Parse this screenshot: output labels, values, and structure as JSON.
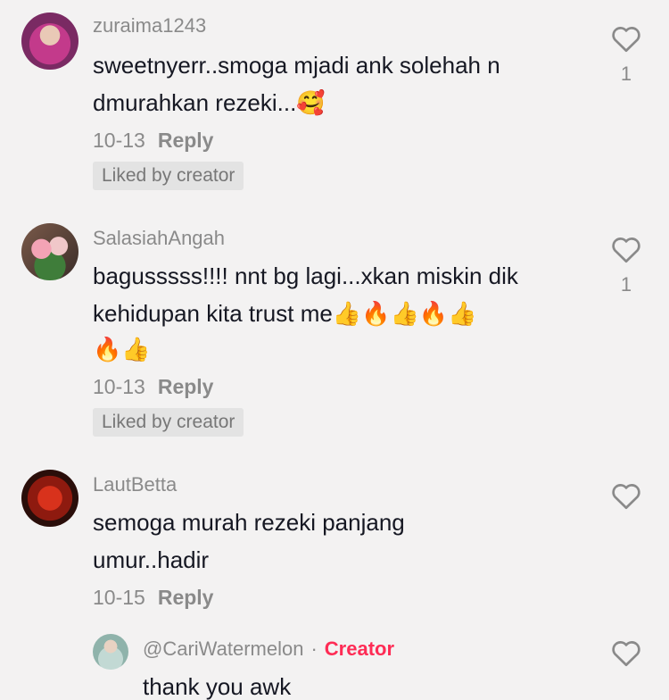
{
  "comments": [
    {
      "username": "zuraima1243",
      "lines": [
        "sweetnyerr..smoga mjadi ank solehah n",
        "dmurahkan rezeki...🥰"
      ],
      "date": "10-13",
      "reply_label": "Reply",
      "badge": "Liked by creator",
      "likes": "1",
      "heart_icon": "heart-outline-icon"
    },
    {
      "username": "SalasiahAngah",
      "lines": [
        "bagusssss!!!! nnt bg lagi...xkan miskin dik",
        "kehidupan kita trust me👍🔥👍🔥👍",
        "🔥👍"
      ],
      "date": "10-13",
      "reply_label": "Reply",
      "badge": "Liked by creator",
      "likes": "1",
      "heart_icon": "heart-outline-icon"
    },
    {
      "username": "LautBetta",
      "lines": [
        "semoga murah rezeki panjang",
        "umur..hadir"
      ],
      "date": "10-15",
      "reply_label": "Reply",
      "heart_icon": "heart-outline-icon"
    }
  ],
  "reply": {
    "username": "@CariWatermelon",
    "separator": "·",
    "creator_label": "Creator",
    "text": "thank you awk",
    "heart_icon": "heart-outline-icon"
  },
  "colors": {
    "background": "#f3f2f2",
    "text": "#161823",
    "muted": "#8a8a8a",
    "creator": "#fe2c55"
  }
}
